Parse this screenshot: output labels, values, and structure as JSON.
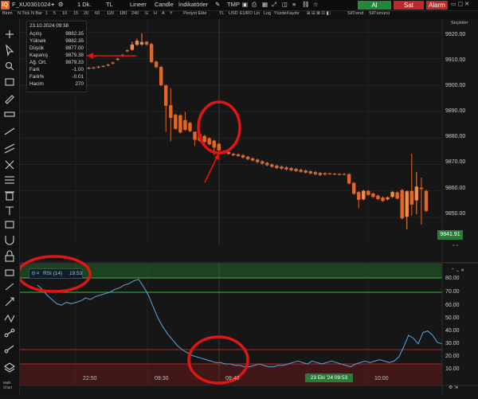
{
  "header": {
    "logo": "IQ",
    "symbol": "F_XU0301024",
    "interval": "1 Dk.",
    "currency": "TL",
    "scale": "Lineer",
    "chart_type": "Candle",
    "indicators": "İndikatörler",
    "tmp": "TMP",
    "buy": "Al",
    "sell": "Sat",
    "alarm": "Alarm"
  },
  "subtoolbar": {
    "items": [
      "Birim",
      "N Tick",
      "N Bar",
      "1",
      "5",
      "10",
      "15",
      "20",
      "60",
      "120",
      "180",
      "240",
      "G",
      "H",
      "A",
      "Y",
      "Periyot Ekle",
      "TL",
      "USD",
      "EURO",
      "Lin",
      "Log",
      "Yüzde",
      "Kaydır",
      "SilTrend",
      "SilTümünü"
    ],
    "right": "Seçimler"
  },
  "infobox": {
    "datetime": "23.10.2024 09:38",
    "rows": [
      {
        "k": "Açılış",
        "v": "9882.35"
      },
      {
        "k": "Yüksek",
        "v": "9882.35"
      },
      {
        "k": "Düşük",
        "v": "9877.00"
      },
      {
        "k": "Kapanış",
        "v": "9879.38"
      },
      {
        "k": "Ağ. Ort.",
        "v": "9879.33"
      },
      {
        "k": "Fark",
        "v": "-1.00"
      },
      {
        "k": "Fark%",
        "v": "-0.01"
      },
      {
        "k": "Hacim",
        "v": "270"
      }
    ]
  },
  "price_axis": {
    "labels": [
      "9920.00",
      "9910.00",
      "9900.00",
      "9890.00",
      "9880.00",
      "9870.00",
      "9860.00",
      "9850.00"
    ],
    "last_price": "9841.91"
  },
  "rsi": {
    "label": "RSI (14)",
    "time": "19:53",
    "axis": [
      "80.00",
      "70.00",
      "60.00",
      "50.00",
      "40.00",
      "30.00",
      "20.00",
      "10.00"
    ]
  },
  "time_axis": {
    "labels": [
      "22:50",
      "09:30",
      "09:40",
      "10:00"
    ],
    "crosshair": "23 Eki '24 09:53"
  },
  "colors": {
    "bull": "#f08c4a",
    "bear": "#e0662a",
    "annotation": "#e01515",
    "rsi_line": "#5aa7e0",
    "upper_band": "#35b54a",
    "lower_band": "#b02525"
  },
  "chart_data": {
    "type": "candlestick",
    "price": {
      "ylim": [
        9840,
        9925
      ],
      "candles": [
        {
          "o": 9898.6,
          "c": 9898.5,
          "h": 9898.8,
          "l": 9898.3
        },
        {
          "o": 9899.5,
          "c": 9899.3,
          "h": 9899.8,
          "l": 9899.0
        },
        {
          "o": 9901.5,
          "c": 9901.2,
          "h": 9901.9,
          "l": 9900.9
        },
        {
          "o": 9903.3,
          "c": 9903.0,
          "h": 9903.7,
          "l": 9902.7
        },
        {
          "o": 9904.8,
          "c": 9904.4,
          "h": 9905.1,
          "l": 9904.1
        },
        {
          "o": 9905.4,
          "c": 9905.1,
          "h": 9905.8,
          "l": 9904.8
        },
        {
          "o": 9906.0,
          "c": 9905.6,
          "h": 9906.4,
          "l": 9905.3
        },
        {
          "o": 9906.2,
          "c": 9906.0,
          "h": 9906.5,
          "l": 9905.7
        },
        {
          "o": 9906.4,
          "c": 9906.2,
          "h": 9906.7,
          "l": 9905.9
        },
        {
          "o": 9906.6,
          "c": 9906.3,
          "h": 9906.9,
          "l": 9906.0
        },
        {
          "o": 9906.7,
          "c": 9906.5,
          "h": 9907.0,
          "l": 9906.2
        },
        {
          "o": 9907.0,
          "c": 9906.7,
          "h": 9907.4,
          "l": 9906.4
        },
        {
          "o": 9907.3,
          "c": 9907.0,
          "h": 9907.6,
          "l": 9906.7
        },
        {
          "o": 9907.8,
          "c": 9907.5,
          "h": 9908.1,
          "l": 9907.1
        },
        {
          "o": 9908.6,
          "c": 9908.2,
          "h": 9909.0,
          "l": 9907.9
        },
        {
          "o": 9910.0,
          "c": 9909.6,
          "h": 9910.4,
          "l": 9909.2
        },
        {
          "o": 9911.5,
          "c": 9911.1,
          "h": 9911.9,
          "l": 9910.7
        },
        {
          "o": 9913.2,
          "c": 9912.8,
          "h": 9913.6,
          "l": 9912.5
        },
        {
          "o": 9913.4,
          "c": 9915.4,
          "h": 9916.5,
          "l": 9913.0
        },
        {
          "o": 9915.3,
          "c": 9916.8,
          "h": 9917.6,
          "l": 9914.8
        },
        {
          "o": 9915.4,
          "c": 9916.3,
          "h": 9919.6,
          "l": 9914.9
        },
        {
          "o": 9916.4,
          "c": 9915.4,
          "h": 9916.8,
          "l": 9914.9
        },
        {
          "o": 9915.6,
          "c": 9908.7,
          "h": 9916.0,
          "l": 9908.3
        },
        {
          "o": 9908.9,
          "c": 9906.8,
          "h": 9909.3,
          "l": 9906.4
        },
        {
          "o": 9906.9,
          "c": 9900.0,
          "h": 9907.3,
          "l": 9899.6
        },
        {
          "o": 9899.9,
          "c": 9892.2,
          "h": 9900.3,
          "l": 9882.3
        },
        {
          "o": 9892.4,
          "c": 9887.6,
          "h": 9898.8,
          "l": 9878.8
        },
        {
          "o": 9888.8,
          "c": 9883.5,
          "h": 9889.2,
          "l": 9883.1
        },
        {
          "o": 9888.6,
          "c": 9882.1,
          "h": 9889.0,
          "l": 9881.7
        },
        {
          "o": 9886.8,
          "c": 9883.1,
          "h": 9889.9,
          "l": 9882.7
        },
        {
          "o": 9885.7,
          "c": 9882.6,
          "h": 9886.1,
          "l": 9882.2
        },
        {
          "o": 9882.4,
          "c": 9879.3,
          "h": 9882.4,
          "l": 9877.0
        },
        {
          "o": 9881.5,
          "c": 9879.0,
          "h": 9881.9,
          "l": 9878.6
        },
        {
          "o": 9880.8,
          "c": 9878.5,
          "h": 9881.2,
          "l": 9878.1
        },
        {
          "o": 9879.9,
          "c": 9877.6,
          "h": 9880.3,
          "l": 9877.2
        },
        {
          "o": 9879.0,
          "c": 9876.4,
          "h": 9879.4,
          "l": 9873.6
        },
        {
          "o": 9877.8,
          "c": 9875.3,
          "h": 9878.2,
          "l": 9874.9
        },
        {
          "o": 9875.0,
          "c": 9874.5,
          "h": 9875.4,
          "l": 9874.1
        },
        {
          "o": 9874.7,
          "c": 9874.0,
          "h": 9875.1,
          "l": 9873.6
        },
        {
          "o": 9874.0,
          "c": 9873.5,
          "h": 9874.4,
          "l": 9873.1
        },
        {
          "o": 9873.8,
          "c": 9873.2,
          "h": 9874.2,
          "l": 9872.8
        },
        {
          "o": 9873.5,
          "c": 9872.6,
          "h": 9873.9,
          "l": 9872.2
        },
        {
          "o": 9872.9,
          "c": 9872.0,
          "h": 9873.3,
          "l": 9871.6
        },
        {
          "o": 9872.3,
          "c": 9871.5,
          "h": 9872.7,
          "l": 9871.1
        },
        {
          "o": 9871.8,
          "c": 9870.9,
          "h": 9872.2,
          "l": 9870.5
        },
        {
          "o": 9871.2,
          "c": 9870.3,
          "h": 9871.6,
          "l": 9869.9
        },
        {
          "o": 9870.6,
          "c": 9869.7,
          "h": 9871.0,
          "l": 9869.3
        },
        {
          "o": 9870.0,
          "c": 9869.1,
          "h": 9870.4,
          "l": 9868.7
        },
        {
          "o": 9869.5,
          "c": 9868.6,
          "h": 9869.9,
          "l": 9868.2
        },
        {
          "o": 9869.2,
          "c": 9868.4,
          "h": 9869.6,
          "l": 9868.0
        },
        {
          "o": 9868.9,
          "c": 9868.1,
          "h": 9869.3,
          "l": 9867.7
        },
        {
          "o": 9868.6,
          "c": 9867.8,
          "h": 9869.0,
          "l": 9867.4
        },
        {
          "o": 9868.3,
          "c": 9867.5,
          "h": 9868.7,
          "l": 9867.1
        },
        {
          "o": 9868.0,
          "c": 9867.2,
          "h": 9868.4,
          "l": 9866.8
        },
        {
          "o": 9867.7,
          "c": 9866.9,
          "h": 9868.1,
          "l": 9866.5
        },
        {
          "o": 9867.4,
          "c": 9866.6,
          "h": 9867.8,
          "l": 9866.2
        },
        {
          "o": 9867.1,
          "c": 9866.3,
          "h": 9867.5,
          "l": 9865.9
        },
        {
          "o": 9866.8,
          "c": 9866.0,
          "h": 9867.2,
          "l": 9865.6
        },
        {
          "o": 9866.7,
          "c": 9866.2,
          "h": 9867.0,
          "l": 9865.8
        },
        {
          "o": 9866.6,
          "c": 9866.5,
          "h": 9866.9,
          "l": 9866.2
        },
        {
          "o": 9866.5,
          "c": 9866.3,
          "h": 9866.8,
          "l": 9866.0
        },
        {
          "o": 9866.4,
          "c": 9866.2,
          "h": 9866.7,
          "l": 9865.9
        },
        {
          "o": 9866.4,
          "c": 9866.3,
          "h": 9866.7,
          "l": 9866.0
        },
        {
          "o": 9866.3,
          "c": 9862.8,
          "h": 9866.7,
          "l": 9862.4
        },
        {
          "o": 9863.0,
          "c": 9858.9,
          "h": 9863.4,
          "l": 9858.5
        },
        {
          "o": 9859.5,
          "c": 9856.6,
          "h": 9859.9,
          "l": 9853.4
        },
        {
          "o": 9856.8,
          "c": 9860.0,
          "h": 9860.4,
          "l": 9856.4
        },
        {
          "o": 9860.0,
          "c": 9858.5,
          "h": 9860.4,
          "l": 9858.1
        },
        {
          "o": 9859.0,
          "c": 9857.7,
          "h": 9859.4,
          "l": 9857.3
        },
        {
          "o": 9858.2,
          "c": 9856.9,
          "h": 9858.6,
          "l": 9856.5
        },
        {
          "o": 9857.5,
          "c": 9856.2,
          "h": 9857.9,
          "l": 9855.8
        },
        {
          "o": 9856.8,
          "c": 9857.5,
          "h": 9857.9,
          "l": 9856.4
        },
        {
          "o": 9857.7,
          "c": 9859.6,
          "h": 9860.0,
          "l": 9857.3
        },
        {
          "o": 9859.4,
          "c": 9857.1,
          "h": 9859.8,
          "l": 9856.7
        },
        {
          "o": 9860.3,
          "c": 9849.6,
          "h": 9860.7,
          "l": 9849.2
        },
        {
          "o": 9850.2,
          "c": 9859.8,
          "h": 9860.2,
          "l": 9845.4
        },
        {
          "o": 9860.0,
          "c": 9854.8,
          "h": 9874.1,
          "l": 9850.6
        },
        {
          "o": 9856.4,
          "c": 9861.6,
          "h": 9867.2,
          "l": 9851.2
        },
        {
          "o": 9861.2,
          "c": 9860.7,
          "h": 9865.0,
          "l": 9847.2
        },
        {
          "o": 9860.0,
          "c": 9852.4,
          "h": 9860.4,
          "l": 9852.0
        }
      ]
    },
    "rsi": {
      "ylim": [
        5,
        90
      ],
      "bands": [
        80,
        70,
        30,
        20
      ],
      "values": [
        75,
        72,
        68,
        65,
        62,
        61,
        63,
        62,
        63,
        64,
        66,
        65,
        67,
        68,
        69,
        70,
        72,
        73,
        75,
        76,
        78,
        79,
        74,
        68,
        60,
        52,
        46,
        41,
        37,
        33,
        30,
        28,
        26,
        25,
        24,
        23,
        22,
        21,
        21,
        20,
        20,
        19,
        19,
        18,
        18,
        19,
        20,
        19,
        18,
        18,
        19,
        19,
        20,
        21,
        22,
        21,
        20,
        22,
        21,
        20,
        21,
        22,
        21,
        20,
        19,
        18,
        20,
        21,
        22,
        21,
        22,
        23,
        22,
        21,
        22,
        25,
        32,
        40,
        38,
        34,
        42,
        43,
        40,
        35,
        34
      ]
    }
  }
}
